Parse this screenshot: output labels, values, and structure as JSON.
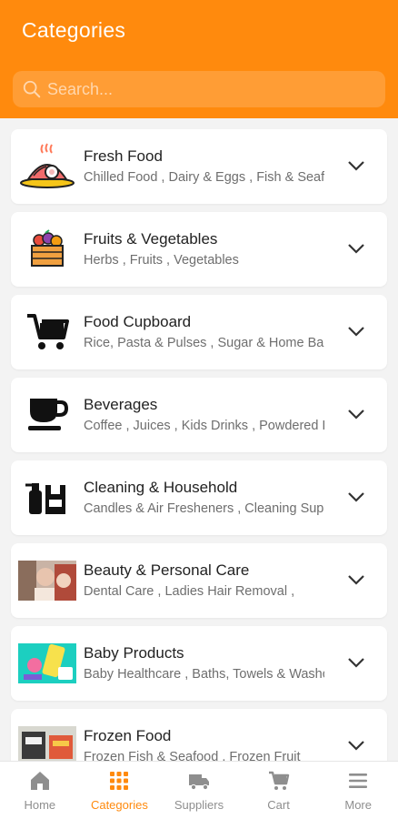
{
  "header": {
    "title": "Categories"
  },
  "search": {
    "placeholder": "Search..."
  },
  "categories": [
    {
      "name": "Fresh Food",
      "sub": "Chilled Food ,  Dairy & Eggs ,  Fish & Seafood",
      "icon": "fresh-food-icon"
    },
    {
      "name": "Fruits & Vegetables",
      "sub": "Herbs ,  Fruits ,  Vegetables",
      "icon": "fruit-basket-icon"
    },
    {
      "name": "Food Cupboard",
      "sub": "Rice, Pasta & Pulses ,  Sugar & Home Baking",
      "icon": "shopping-cart-icon"
    },
    {
      "name": "Beverages",
      "sub": "Coffee ,  Juices ,  Kids Drinks ,  Powdered Drinks",
      "icon": "cup-icon"
    },
    {
      "name": "Cleaning & Household",
      "sub": "Candles & Air Fresheners ,  Cleaning Supplies",
      "icon": "cleaning-icon"
    },
    {
      "name": "Beauty & Personal Care",
      "sub": "Dental Care ,  Ladies Hair Removal ,",
      "icon": "beauty-photo"
    },
    {
      "name": "Baby Products",
      "sub": "Baby Healthcare ,  Baths, Towels & Washcloths",
      "icon": "baby-products-photo"
    },
    {
      "name": "Frozen Food",
      "sub": "Frozen Fish & Seafood ,  Frozen Fruit",
      "icon": "frozen-food-photo"
    }
  ],
  "tabbar": {
    "items": [
      {
        "label": "Home",
        "icon": "home-icon",
        "active": false
      },
      {
        "label": "Categories",
        "icon": "grid-icon",
        "active": true
      },
      {
        "label": "Suppliers",
        "icon": "truck-icon",
        "active": false
      },
      {
        "label": "Cart",
        "icon": "cart-icon",
        "active": false
      },
      {
        "label": "More",
        "icon": "menu-icon",
        "active": false
      }
    ]
  },
  "colors": {
    "accent": "#ff8a0d",
    "inactive": "#8e8e8e"
  }
}
